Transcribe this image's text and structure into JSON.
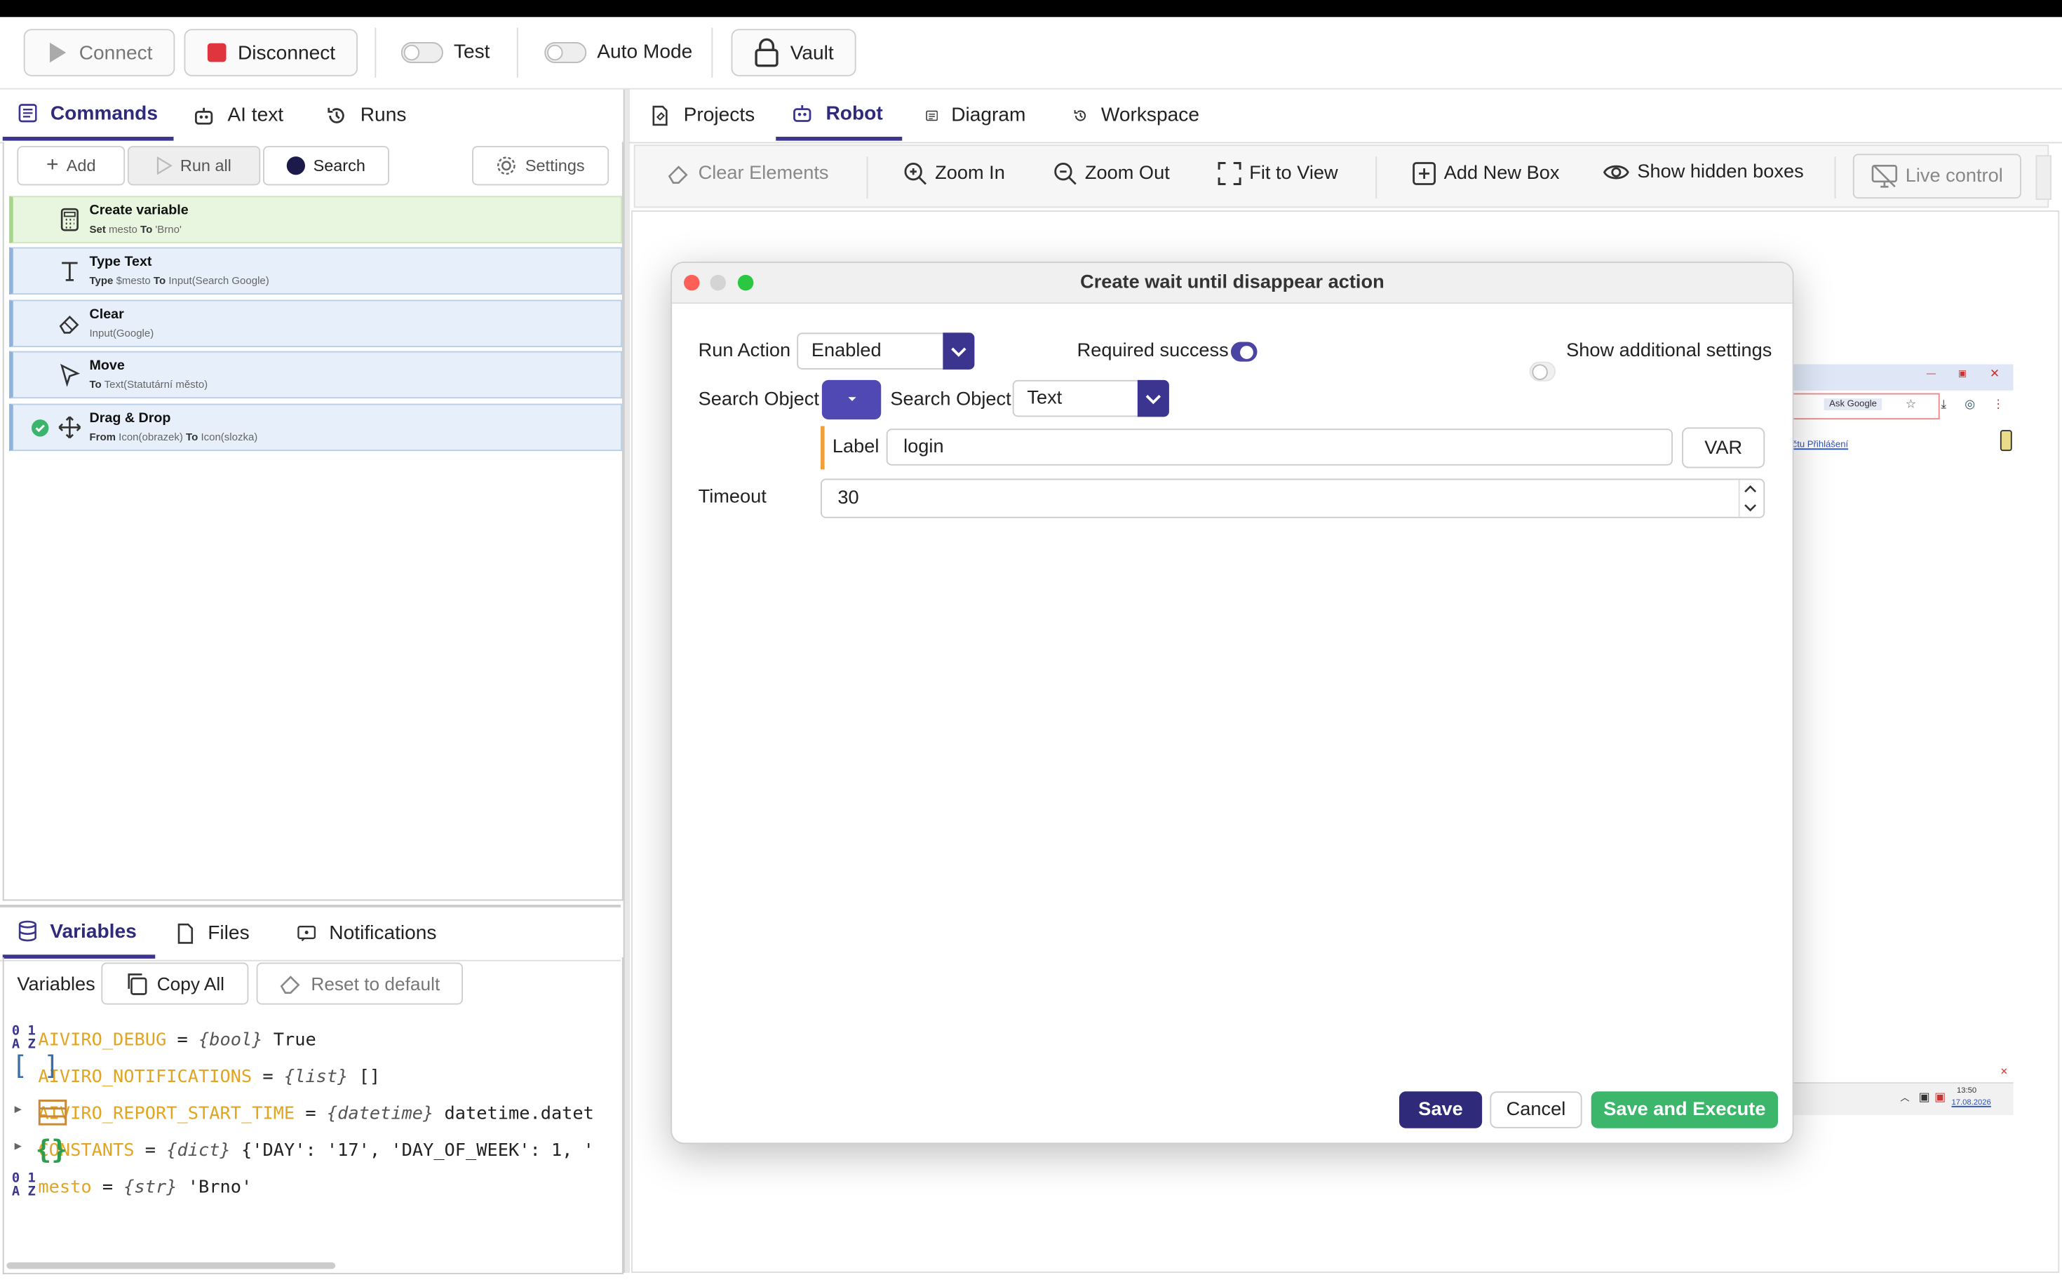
{
  "toolbar": {
    "connect": "Connect",
    "disconnect": "Disconnect",
    "test": "Test",
    "auto_mode": "Auto Mode",
    "vault": "Vault"
  },
  "left_tabs": [
    "Commands",
    "AI text",
    "Runs"
  ],
  "commands_toolbar": {
    "add": "Add",
    "run_all": "Run all",
    "search": "Search",
    "settings": "Settings"
  },
  "commands": [
    {
      "title": "Create variable",
      "parts": [
        [
          "Set",
          " mesto "
        ],
        [
          "To",
          " 'Brno'"
        ]
      ],
      "icon": "calculator-icon",
      "color": "green"
    },
    {
      "title": "Type Text",
      "parts": [
        [
          "Type",
          " $mesto "
        ],
        [
          "To",
          " Input(Search Google)"
        ]
      ],
      "icon": "text-icon",
      "color": "blue"
    },
    {
      "title": "Clear",
      "parts": [
        [
          "",
          "Input(Google)"
        ]
      ],
      "icon": "eraser-icon",
      "color": "blue"
    },
    {
      "title": "Move",
      "parts": [
        [
          "To",
          " Text(Statutární město)"
        ]
      ],
      "icon": "cursor-icon",
      "color": "blue"
    },
    {
      "title": "Drag & Drop",
      "parts": [
        [
          "From",
          " Icon(obrazek) "
        ],
        [
          "To",
          " Icon(slozka)"
        ]
      ],
      "icon": "move-icon",
      "color": "blue"
    }
  ],
  "bottom_tabs": [
    "Variables",
    "Files",
    "Notifications"
  ],
  "variables_toolbar": {
    "label": "Variables",
    "copy_all": "Copy All",
    "reset": "Reset to default"
  },
  "variables": [
    {
      "name": "AIVIRO_DEBUG",
      "type": "{bool}",
      "value": "True",
      "icon": "0 1\nA Z"
    },
    {
      "name": "AIVIRO_NOTIFICATIONS",
      "type": "{list}",
      "value": "[]",
      "icon": "[ ]"
    },
    {
      "name": "AIVIRO_REPORT_START_TIME",
      "type": "{datetime}",
      "value": "datetime.datet",
      "icon": "table"
    },
    {
      "name": "CONSTANTS",
      "type": "{dict}",
      "value": "{'DAY': '17', 'DAY_OF_WEEK': 1, '",
      "icon": "{ }"
    },
    {
      "name": "mesto",
      "type": "{str}",
      "value": "'Brno'",
      "icon": "0 1\nA Z"
    }
  ],
  "right_tabs": [
    "Projects",
    "Robot",
    "Diagram",
    "Workspace"
  ],
  "robot_toolbar": {
    "clear_elements": "Clear Elements",
    "zoom_in": "Zoom In",
    "zoom_out": "Zoom Out",
    "fit": "Fit to View",
    "add_box": "Add New Box",
    "show_hidden": "Show hidden boxes",
    "live": "Live control"
  },
  "modal": {
    "title": "Create wait until disappear action",
    "run_action_label": "Run Action",
    "run_action_value": "Enabled",
    "required_success": "Required success",
    "show_additional": "Show additional settings",
    "search_object_label": "Search Object",
    "search_object_label2": "Search Object",
    "search_object_value": "Text",
    "label_label": "Label",
    "label_value": "login",
    "var_button": "VAR",
    "timeout_label": "Timeout",
    "timeout_value": "30",
    "save": "Save",
    "cancel": "Cancel",
    "save_execute": "Save and Execute"
  },
  "bg_preview": {
    "ask_google": "Ask Google",
    "link_text": "čtu  Přihlášení",
    "time": "13:50",
    "date": "17.08.2026"
  },
  "colors": {
    "accent": "#3b3590",
    "green": "#3bb56b",
    "var_name": "#e2a521"
  }
}
